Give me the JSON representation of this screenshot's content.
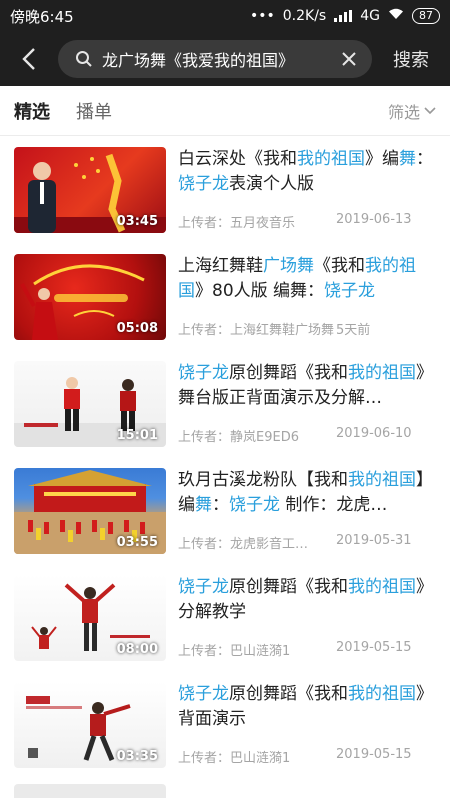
{
  "status_bar": {
    "time": "傍晚6:45",
    "dots": "•••",
    "speed": "0.2K/s",
    "network": "4G",
    "battery": "87"
  },
  "header": {
    "search_text": "龙广场舞《我爱我的祖国》",
    "search_button": "搜索"
  },
  "tabs": {
    "selected": "精选",
    "playlist": "播单",
    "filter": "筛选"
  },
  "results": [
    {
      "title_parts": [
        {
          "t": "白云深处《我和",
          "hl": false
        },
        {
          "t": "我的祖国",
          "hl": true
        },
        {
          "t": "》编",
          "hl": false
        },
        {
          "t": "舞",
          "hl": true
        },
        {
          "t": "：",
          "hl": false
        },
        {
          "t": "饶子龙",
          "hl": true
        },
        {
          "t": "表演个人版",
          "hl": false
        }
      ],
      "uploader": "上传者：五月夜音乐",
      "date": "2019-06-13",
      "duration": "03:45"
    },
    {
      "title_parts": [
        {
          "t": "上海红舞鞋",
          "hl": false
        },
        {
          "t": "广场舞",
          "hl": true
        },
        {
          "t": "《我和",
          "hl": false
        },
        {
          "t": "我的祖国",
          "hl": true
        },
        {
          "t": "》80人版  编舞：",
          "hl": false
        },
        {
          "t": "饶子龙",
          "hl": true
        }
      ],
      "uploader": "上传者：上海红舞鞋广场舞",
      "date": "5天前",
      "duration": "05:08"
    },
    {
      "title_parts": [
        {
          "t": "饶子龙",
          "hl": true
        },
        {
          "t": "原创舞蹈《我和",
          "hl": false
        },
        {
          "t": "我的祖国",
          "hl": true
        },
        {
          "t": "》舞台版正背面演示及分解…",
          "hl": false
        }
      ],
      "uploader": "上传者：静岚E9ED6",
      "date": "2019-06-10",
      "duration": "15:01"
    },
    {
      "title_parts": [
        {
          "t": "玖月古溪龙粉队【我和",
          "hl": false
        },
        {
          "t": "我的祖国",
          "hl": true
        },
        {
          "t": "】编",
          "hl": false
        },
        {
          "t": "舞",
          "hl": true
        },
        {
          "t": "：",
          "hl": false
        },
        {
          "t": "饶子龙",
          "hl": true
        },
        {
          "t": " 制作：龙虎…",
          "hl": false
        }
      ],
      "uploader": "上传者：龙虎影音工…",
      "date": "2019-05-31",
      "duration": "03:55"
    },
    {
      "title_parts": [
        {
          "t": "饶子龙",
          "hl": true
        },
        {
          "t": "原创舞蹈《我和",
          "hl": false
        },
        {
          "t": "我的祖国",
          "hl": true
        },
        {
          "t": "》分解教学",
          "hl": false
        }
      ],
      "uploader": "上传者：巴山涟漪1",
      "date": "2019-05-15",
      "duration": "08:00"
    },
    {
      "title_parts": [
        {
          "t": "饶子龙",
          "hl": true
        },
        {
          "t": "原创舞蹈《我和",
          "hl": false
        },
        {
          "t": "我的祖国",
          "hl": true
        },
        {
          "t": "》背面演示",
          "hl": false
        }
      ],
      "uploader": "上传者：巴山涟漪1",
      "date": "2019-05-15",
      "duration": "03:35"
    }
  ],
  "colors": {
    "header_bg": "#1f1f1f",
    "highlight": "#2a9fdc",
    "meta_text": "#a5a5a5"
  },
  "icons": {
    "back": "back-arrow-icon",
    "search": "search-icon",
    "clear": "clear-icon",
    "filter": "chevron-down-icon"
  }
}
